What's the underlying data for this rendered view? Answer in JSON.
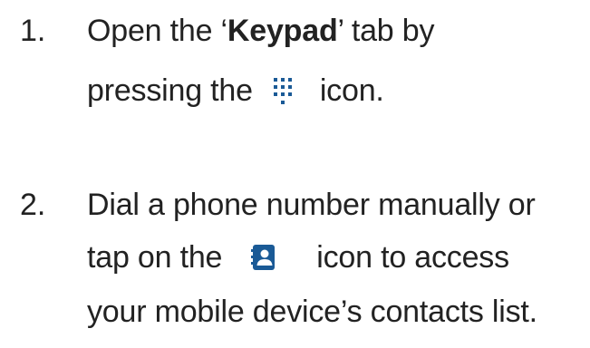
{
  "steps": [
    {
      "number": "1.",
      "line1_before": "Open the ‘",
      "line1_bold": "Keypad",
      "line1_after": "’ tab by",
      "line2_before": "pressing the",
      "line2_after": "icon.",
      "icon": "keypad-icon"
    },
    {
      "number": "2.",
      "line1": "Dial a phone number manually or",
      "line2_before": "tap on the",
      "line2_after": "icon to access",
      "line3": "your mobile device’s contacts list.",
      "icon": "contacts-icon"
    }
  ],
  "colors": {
    "text": "#222222",
    "icon_blue": "#1a5a96"
  }
}
